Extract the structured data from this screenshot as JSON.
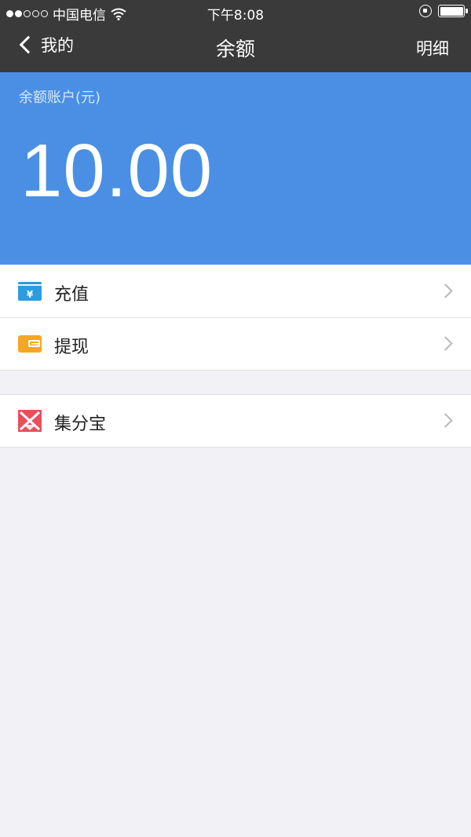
{
  "status_bar": {
    "carrier": "中国电信",
    "time": "下午8:08"
  },
  "nav": {
    "back_label": "我的",
    "title": "余额",
    "right_label": "明细"
  },
  "balance": {
    "label": "余额账户(元)",
    "amount": "10.00"
  },
  "menu": {
    "recharge_label": "充值",
    "withdraw_label": "提现",
    "points_label": "集分宝"
  },
  "colors": {
    "nav_bg": "#3a3a3a",
    "balance_bg": "#4a8fe4",
    "recharge_icon": "#2b9ce0",
    "withdraw_icon": "#f5a623",
    "points_icon": "#e8505b",
    "page_bg": "#f2f2f6"
  },
  "icons": {
    "recharge": "yen-card-icon",
    "withdraw": "wallet-icon",
    "points": "jifenbao-icon"
  }
}
